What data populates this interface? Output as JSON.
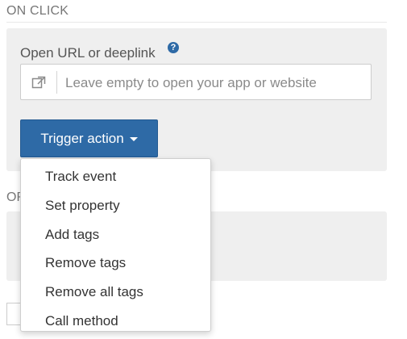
{
  "on_click": {
    "heading": "ON CLICK",
    "url_field": {
      "label": "Open URL or deeplink",
      "help_icon": "question-circle-icon",
      "addon_icon": "external-link-icon",
      "placeholder": "Leave empty to open your app or website",
      "value": ""
    },
    "trigger_button": {
      "label": "Trigger action",
      "caret_icon": "caret-down-icon"
    }
  },
  "or_section": {
    "label": "OR"
  },
  "dropdown": {
    "items": [
      "Track event",
      "Set property",
      "Add tags",
      "Remove tags",
      "Remove all tags",
      "Call method"
    ]
  },
  "colors": {
    "primary": "#2e6aa6",
    "panel_bg": "#efefef",
    "muted_text": "#777777"
  }
}
